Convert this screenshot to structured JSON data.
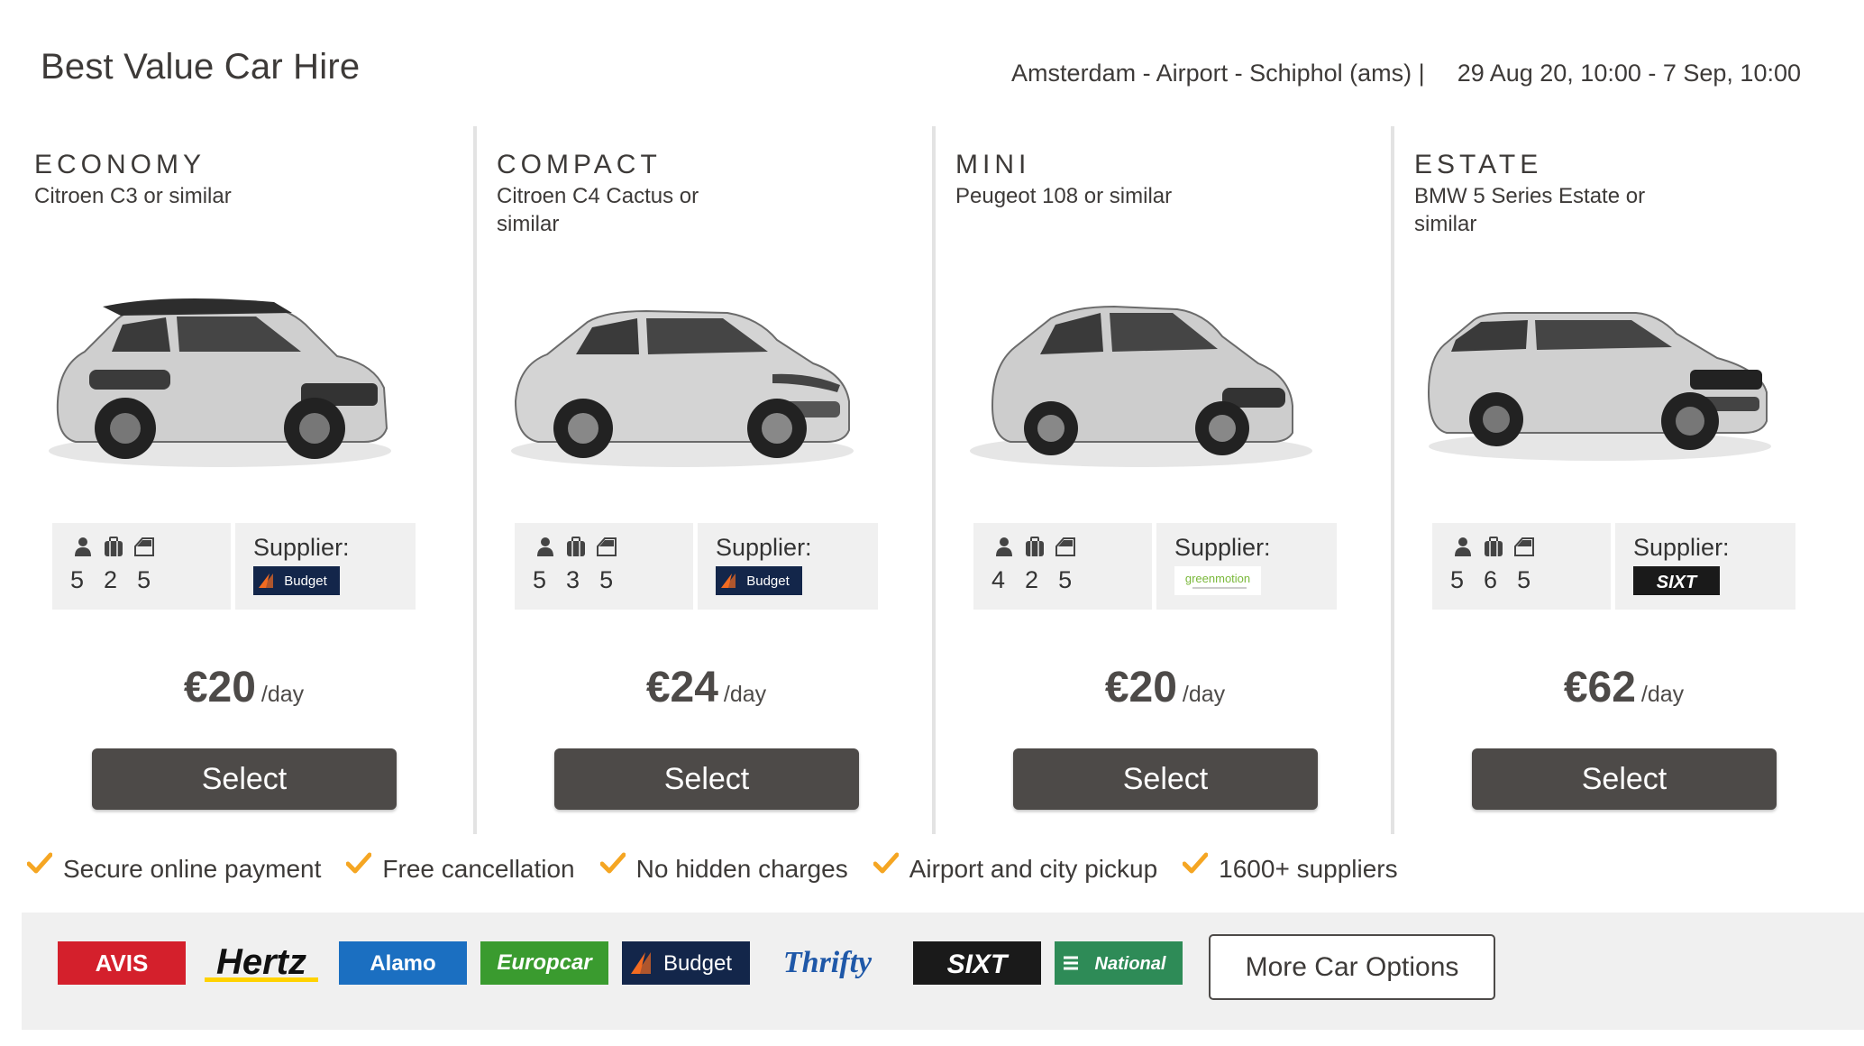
{
  "header": {
    "title": "Best Value Car Hire",
    "location": "Amsterdam - Airport - Schiphol (ams) |",
    "dates": "29 Aug 20, 10:00 - 7 Sep, 10:00"
  },
  "icons": {
    "passengers": "person-icon",
    "large_bags": "suitcase-icon",
    "doors": "car-door-icon",
    "check": "checkmark-icon"
  },
  "colors": {
    "button": "#4d4a48",
    "check": "#f5a623",
    "panel": "#f0f0f0"
  },
  "cards": [
    {
      "category": "ECONOMY",
      "model": "Citroen C3 or similar",
      "passengers": "5",
      "bags": "2",
      "doors": "5",
      "supplier_label": "Supplier:",
      "supplier": "Budget",
      "price": "€20",
      "per": "/day",
      "button": "Select"
    },
    {
      "category": "COMPACT",
      "model": "Citroen C4 Cactus or similar",
      "passengers": "5",
      "bags": "3",
      "doors": "5",
      "supplier_label": "Supplier:",
      "supplier": "Budget",
      "price": "€24",
      "per": "/day",
      "button": "Select"
    },
    {
      "category": "MINI",
      "model": "Peugeot 108 or similar",
      "passengers": "4",
      "bags": "2",
      "doors": "5",
      "supplier_label": "Supplier:",
      "supplier": "greenmotion",
      "price": "€20",
      "per": "/day",
      "button": "Select"
    },
    {
      "category": "ESTATE",
      "model": "BMW 5 Series Estate or similar",
      "passengers": "5",
      "bags": "6",
      "doors": "5",
      "supplier_label": "Supplier:",
      "supplier": "SIXT",
      "price": "€62",
      "per": "/day",
      "button": "Select"
    }
  ],
  "benefits": [
    "Secure online payment",
    "Free cancellation",
    "No hidden charges",
    "Airport and city pickup",
    "1600+ suppliers"
  ],
  "supplier_logos": [
    "AVIS",
    "Hertz",
    "Alamo",
    "Europcar",
    "Budget",
    "Thrifty",
    "SIXT",
    "National"
  ],
  "more_button": "More Car Options"
}
